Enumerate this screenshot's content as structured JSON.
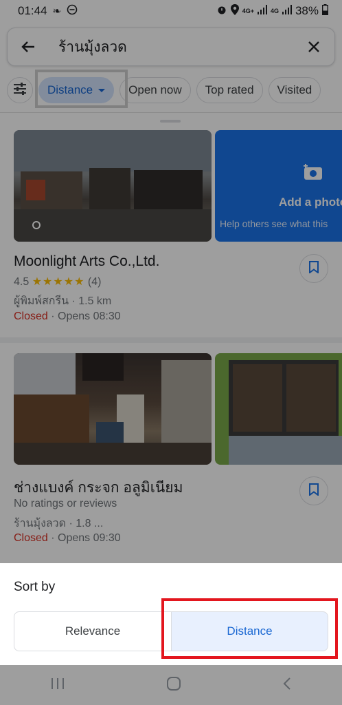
{
  "status_bar": {
    "time": "01:44",
    "net1": "4G+",
    "net2": "4G",
    "battery": "38%"
  },
  "search": {
    "query": "ร้านมุ้งลวด",
    "back_icon": "arrow-back-icon",
    "clear_icon": "close-icon"
  },
  "chips": [
    {
      "label": "Distance"
    },
    {
      "label": "Open now"
    },
    {
      "label": "Top rated"
    },
    {
      "label": "Visited"
    }
  ],
  "results": [
    {
      "name": "Moonlight Arts Co.,Ltd.",
      "rating": "4.5",
      "stars": "★★★★★",
      "reviews": "(4)",
      "category_distance": "ผู้พิมพ์สกรีน · 1.5 km",
      "status": "Closed",
      "opens": "· Opens 08:30",
      "add_photo_title": "Add a photo",
      "add_photo_sub": "Help others see what this"
    },
    {
      "name": "ช่างแบงค์ กระจก อลูมิเนียม",
      "rating_text": "No ratings or reviews",
      "category_distance": "ร้านมุ้งลวด · 1.8 ...",
      "status": "Closed",
      "opens": "· Opens 09:30"
    }
  ],
  "sort_sheet": {
    "title": "Sort by",
    "options": [
      {
        "label": "Relevance",
        "selected": false
      },
      {
        "label": "Distance",
        "selected": true
      }
    ]
  },
  "colors": {
    "accent": "#1967d2",
    "closed": "#d93025",
    "highlight": "#e3161e"
  }
}
